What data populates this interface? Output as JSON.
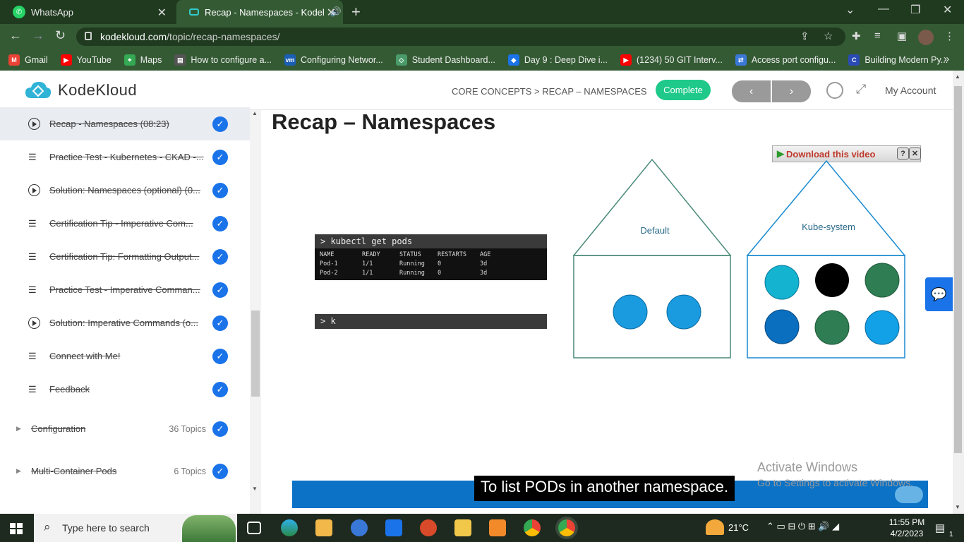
{
  "browser": {
    "tabs": [
      {
        "title": "WhatsApp"
      },
      {
        "title": "Recap - Namespaces - Kodel"
      }
    ],
    "url_domain": "kodekloud.com",
    "url_path": "/topic/recap-namespaces/",
    "bookmarks": [
      {
        "label": "Gmail",
        "color": "#ea4335"
      },
      {
        "label": "YouTube",
        "color": "#ff0000"
      },
      {
        "label": "Maps",
        "color": "#34a853"
      },
      {
        "label": "How to configure a...",
        "color": "#555555"
      },
      {
        "label": "Configuring Networ...",
        "color": "#1a5fb4"
      },
      {
        "label": "Student Dashboard...",
        "color": "#4a9a6a"
      },
      {
        "label": "Day 9 : Deep Dive i...",
        "color": "#1a73e8"
      },
      {
        "label": "(1234) 50 GIT Interv...",
        "color": "#ff0000"
      },
      {
        "label": "Access port configu...",
        "color": "#3a78d8"
      },
      {
        "label": "Building Modern Py...",
        "color": "#2a4bb4"
      }
    ]
  },
  "header": {
    "logo_text": "KodeKloud",
    "breadcrumb": "CORE CONCEPTS > RECAP – NAMESPACES",
    "complete_label": "Complete",
    "prev_label": "‹",
    "next_label": "›",
    "account_label": "My Account"
  },
  "sidebar": {
    "items": [
      {
        "type": "video",
        "label": "Recap - Namespaces (08:23)"
      },
      {
        "type": "doc",
        "label": "Practice Test - Kubernetes - CKAD -..."
      },
      {
        "type": "video",
        "label": "Solution: Namespaces (optional) (0..."
      },
      {
        "type": "doc",
        "label": "Certification Tip - Imperative Com..."
      },
      {
        "type": "doc",
        "label": "Certification Tip: Formatting Output..."
      },
      {
        "type": "doc",
        "label": "Practice Test - Imperative Comman..."
      },
      {
        "type": "video",
        "label": "Solution: Imperative Commands (o..."
      },
      {
        "type": "doc",
        "label": "Connect with Me!"
      },
      {
        "type": "doc",
        "label": "Feedback"
      }
    ],
    "sections": [
      {
        "label": "Configuration",
        "count": "36 Topics"
      },
      {
        "label": "Multi-Container Pods",
        "count": "6 Topics"
      }
    ]
  },
  "content": {
    "title": "Recap – Namespaces",
    "download_label": "Download this video",
    "terminal": {
      "command": "> kubectl get pods",
      "headers": [
        "NAME",
        "READY",
        "STATUS",
        "RESTARTS",
        "AGE"
      ],
      "rows": [
        [
          "Pod-1",
          "1/1",
          "Running",
          "0",
          "3d"
        ],
        [
          "Pod-2",
          "1/1",
          "Running",
          "0",
          "3d"
        ]
      ],
      "prompt2": "> k"
    },
    "diagram": {
      "namespaces": [
        {
          "label": "Default",
          "pods": [
            "#1a9be0",
            "#1a9be0"
          ]
        },
        {
          "label": "Kube-system",
          "pods": [
            "#14b3cf",
            "#000000",
            "#2f7d52",
            "#0b6fbf",
            "#2f7d52",
            "#12a0e6"
          ]
        }
      ],
      "stroke_color": "#4a8a7a"
    },
    "caption": "To list PODs in another namespace.",
    "watermark_line1": "Activate Windows",
    "watermark_line2": "Go to Settings to activate Windows."
  },
  "taskbar": {
    "search_placeholder": "Type here to search",
    "temperature": "21°C",
    "time": "11:55 PM",
    "date": "4/2/2023",
    "notifications": "1"
  },
  "colors": {
    "browser_dark": "#1f3a1f",
    "browser_mid": "#345a34",
    "accent": "#1a73e8",
    "complete": "#1ec98a"
  }
}
